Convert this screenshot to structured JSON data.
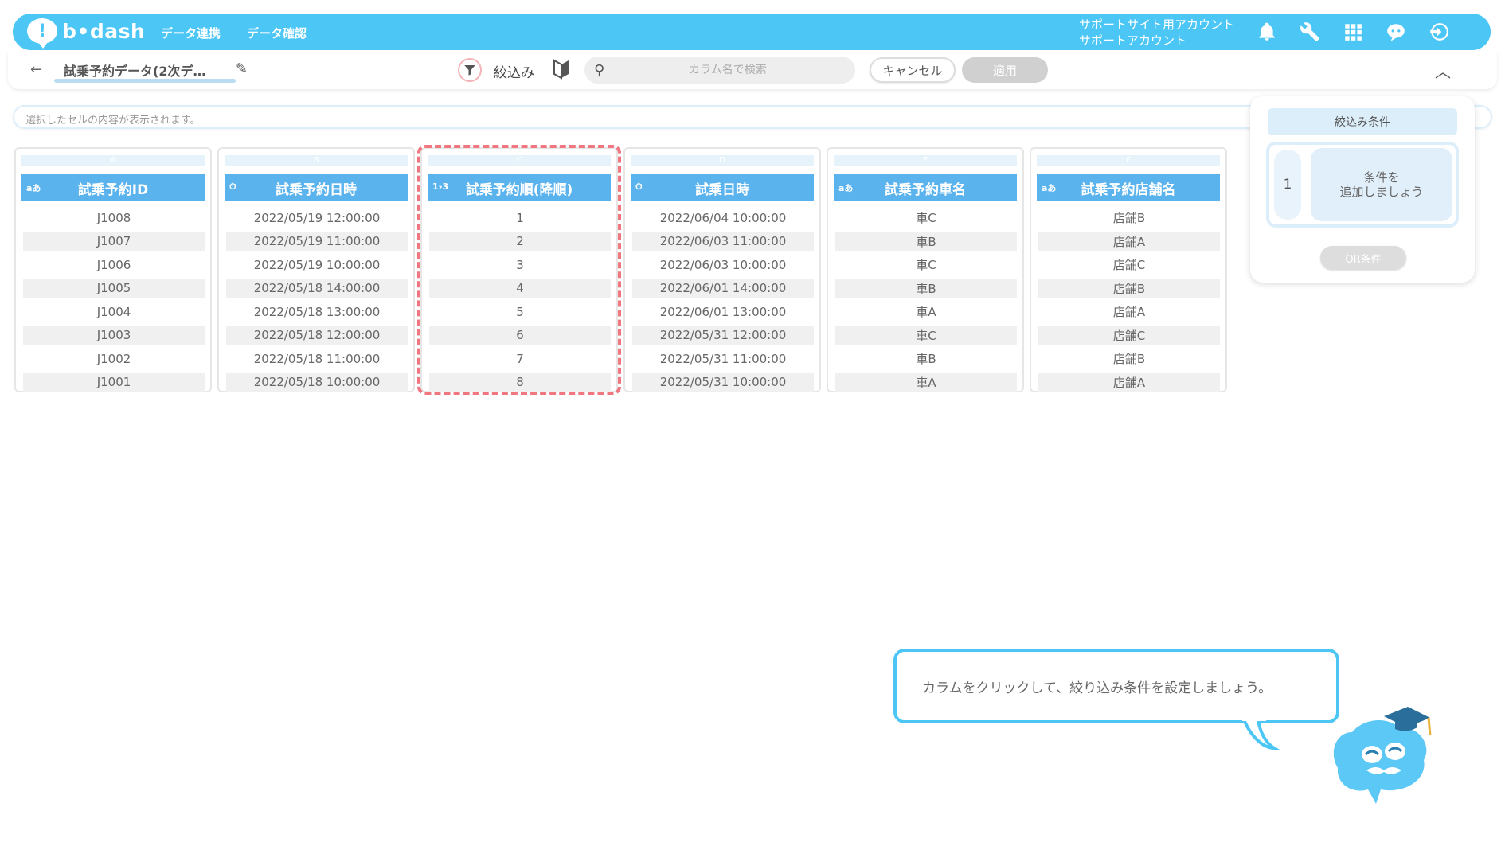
{
  "app": {
    "logo_text": "b•dash",
    "nav": [
      "データ連携",
      "データ確認"
    ],
    "account_line1": "サポートサイト用アカウント",
    "account_line2": "サポートアカウント",
    "icons": [
      "bell-icon",
      "wrench-icon",
      "grid-icon",
      "chat-icon",
      "logout-icon"
    ],
    "accent_color": "#4cc6f5"
  },
  "toolbar": {
    "back_label": "←",
    "sheet_title": "試乗予約データ(2次デ…",
    "filter_label": "絞込み",
    "search_placeholder": "カラム名で検索",
    "cancel_label": "キャンセル",
    "apply_label": "適用"
  },
  "cellbar": {
    "placeholder": "選択したセルの内容が表示されます。"
  },
  "columns": [
    {
      "letter": "A",
      "type": "aあ",
      "name": "試乗予約ID",
      "values": [
        "J1008",
        "J1007",
        "J1006",
        "J1005",
        "J1004",
        "J1003",
        "J1002",
        "J1001"
      ]
    },
    {
      "letter": "B",
      "type": "⏱",
      "name": "試乗予約日時",
      "values": [
        "2022/05/19 12:00:00",
        "2022/05/19 11:00:00",
        "2022/05/19 10:00:00",
        "2022/05/18 14:00:00",
        "2022/05/18 13:00:00",
        "2022/05/18 12:00:00",
        "2022/05/18 11:00:00",
        "2022/05/18 10:00:00"
      ]
    },
    {
      "letter": "C",
      "type": "1₂3",
      "name": "試乗予約順(降順)",
      "values": [
        "1",
        "2",
        "3",
        "4",
        "5",
        "6",
        "7",
        "8"
      ]
    },
    {
      "letter": "D",
      "type": "⏱",
      "name": "試乗日時",
      "values": [
        "2022/06/04 10:00:00",
        "2022/06/03 11:00:00",
        "2022/06/03 10:00:00",
        "2022/06/01 14:00:00",
        "2022/06/01 13:00:00",
        "2022/05/31 12:00:00",
        "2022/05/31 11:00:00",
        "2022/05/31 10:00:00"
      ]
    },
    {
      "letter": "E",
      "type": "aあ",
      "name": "試乗予約車名",
      "values": [
        "車C",
        "車B",
        "車C",
        "車B",
        "車A",
        "車C",
        "車B",
        "車A"
      ]
    },
    {
      "letter": "F",
      "type": "aあ",
      "name": "試乗予約店舗名",
      "values": [
        "店舗B",
        "店舗A",
        "店舗C",
        "店舗B",
        "店舗A",
        "店舗C",
        "店舗B",
        "店舗A"
      ]
    }
  ],
  "panel": {
    "title": "絞込み条件",
    "condition_number": "1",
    "add_condition_text": "条件を\n追加しましょう",
    "or_label": "OR条件"
  },
  "tooltip": {
    "text": "カラムをクリックして、絞り込み条件を設定しましょう。"
  }
}
